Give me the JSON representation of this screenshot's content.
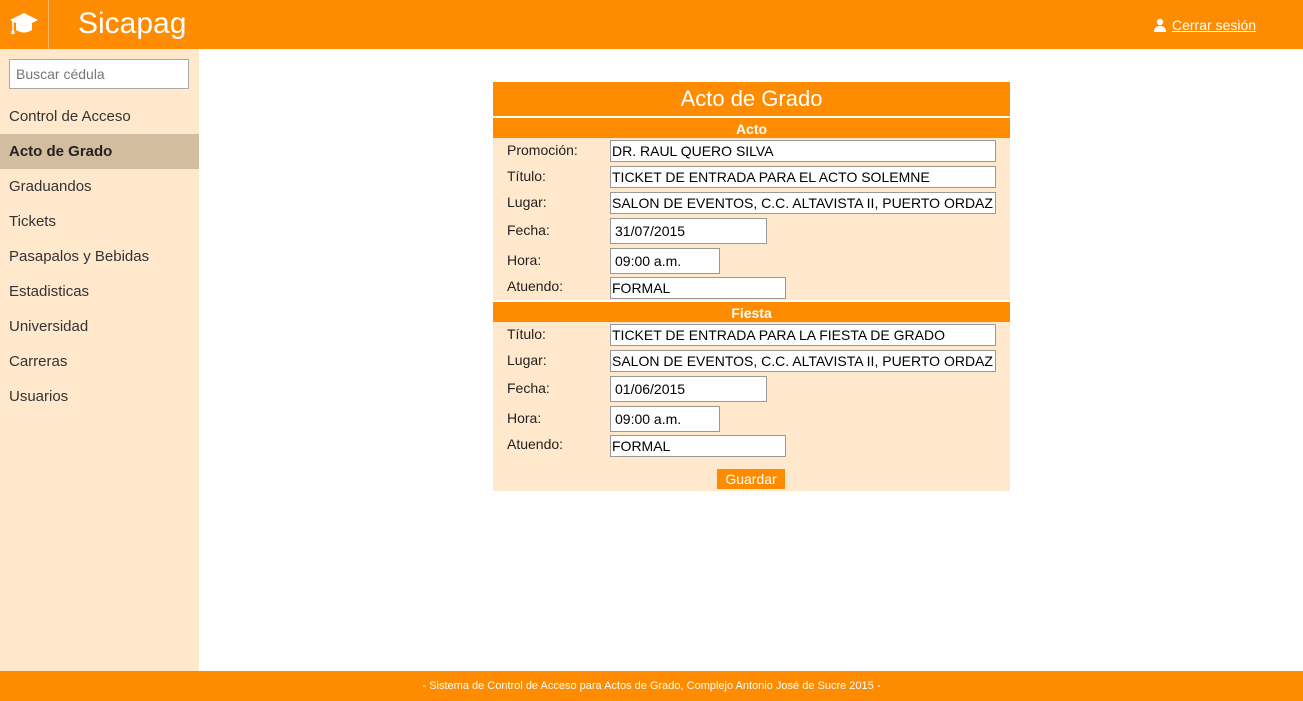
{
  "header": {
    "app_title": "Sicapag",
    "logo_icon": "graduation-cap-icon",
    "logout_label": "Cerrar sesión",
    "logout_icon": "user-icon"
  },
  "sidebar": {
    "search_placeholder": "Buscar cédula",
    "items": [
      {
        "label": "Control de Acceso"
      },
      {
        "label": "Acto de Grado",
        "active": true
      },
      {
        "label": "Graduandos"
      },
      {
        "label": "Tickets"
      },
      {
        "label": "Pasapalos y Bebidas"
      },
      {
        "label": "Estadisticas"
      },
      {
        "label": "Universidad"
      },
      {
        "label": "Carreras"
      },
      {
        "label": "Usuarios"
      }
    ]
  },
  "form": {
    "title": "Acto de Grado",
    "acto": {
      "header": "Acto",
      "promocion_label": "Promoción:",
      "promocion_value": "DR. RAUL QUERO SILVA",
      "titulo_label": "Título:",
      "titulo_value": "TICKET DE ENTRADA PARA EL ACTO SOLEMNE",
      "lugar_label": "Lugar:",
      "lugar_value": "SALON DE EVENTOS, C.C. ALTAVISTA II, PUERTO ORDAZ",
      "fecha_label": "Fecha:",
      "fecha_value": "31/07/2015",
      "hora_label": "Hora:",
      "hora_value": "09:00 a.m.",
      "atuendo_label": "Atuendo:",
      "atuendo_value": "FORMAL"
    },
    "fiesta": {
      "header": "Fiesta",
      "titulo_label": "Título:",
      "titulo_value": "TICKET DE ENTRADA PARA LA FIESTA DE GRADO",
      "lugar_label": "Lugar:",
      "lugar_value": "SALON DE EVENTOS, C.C. ALTAVISTA II, PUERTO ORDAZ",
      "fecha_label": "Fecha:",
      "fecha_value": "01/06/2015",
      "hora_label": "Hora:",
      "hora_value": "09:00 a.m.",
      "atuendo_label": "Atuendo:",
      "atuendo_value": "FORMAL"
    },
    "save_label": "Guardar"
  },
  "footer": {
    "text": "- Sistema de Control de Acceso para Actos de Grado, Complejo Antonio José de Sucre 2015 -"
  },
  "colors": {
    "accent": "#ff8c00",
    "panel_bg": "#ffe8cc",
    "active_nav": "#d3bd9f"
  }
}
